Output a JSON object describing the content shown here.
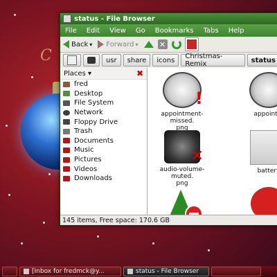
{
  "desktop": {
    "deco_text": "C"
  },
  "window": {
    "title": "status - File Browser",
    "menu": [
      "File",
      "Edit",
      "View",
      "Go",
      "Bookmarks",
      "Tabs",
      "Help"
    ],
    "toolbar": {
      "back_label": "Back",
      "forward_label": "Forward"
    },
    "path_buttons": [
      "usr",
      "share",
      "icons",
      "Christmas-Remix",
      "status"
    ],
    "sidebar": {
      "header": "Places",
      "items": [
        {
          "label": "fred",
          "color": "#8a5a3c"
        },
        {
          "label": "Desktop",
          "color": "#4f8f3f"
        },
        {
          "label": "File System",
          "color": "#555555"
        },
        {
          "label": "Network",
          "color": "#3a3a3a"
        },
        {
          "label": "Floppy Drive",
          "color": "#444444"
        },
        {
          "label": "Trash",
          "color": "#777777"
        },
        {
          "label": "Documents",
          "color": "#b01818"
        },
        {
          "label": "Music",
          "color": "#b01818"
        },
        {
          "label": "Pictures",
          "color": "#b01818"
        },
        {
          "label": "Videos",
          "color": "#b01818"
        },
        {
          "label": "Downloads",
          "color": "#b01818"
        }
      ]
    },
    "files": [
      {
        "name": "appointment-missed.png",
        "line1": "appointment-missed.",
        "line2": "png",
        "icon": "clock-icon"
      },
      {
        "name": "appointm",
        "line1": "appointm",
        "line2": "",
        "icon": "clock-icon"
      },
      {
        "name": "audio-volume-muted.png",
        "line1": "audio-volume-muted.",
        "line2": "png",
        "icon": "speaker-muted-icon"
      },
      {
        "name": "batter",
        "line1": "battery",
        "line2": "",
        "icon": "battery-icon"
      },
      {
        "name": "tree",
        "line1": "",
        "line2": "",
        "icon": "tree-icon"
      },
      {
        "name": "red",
        "line1": "",
        "line2": "",
        "icon": "red-circle-icon"
      }
    ],
    "status": "145 items, Free space: 170.6 GB"
  },
  "taskbar": {
    "tasks": [
      "",
      "[Inbox for fredmck@y...",
      "status - File Browser",
      ""
    ]
  }
}
